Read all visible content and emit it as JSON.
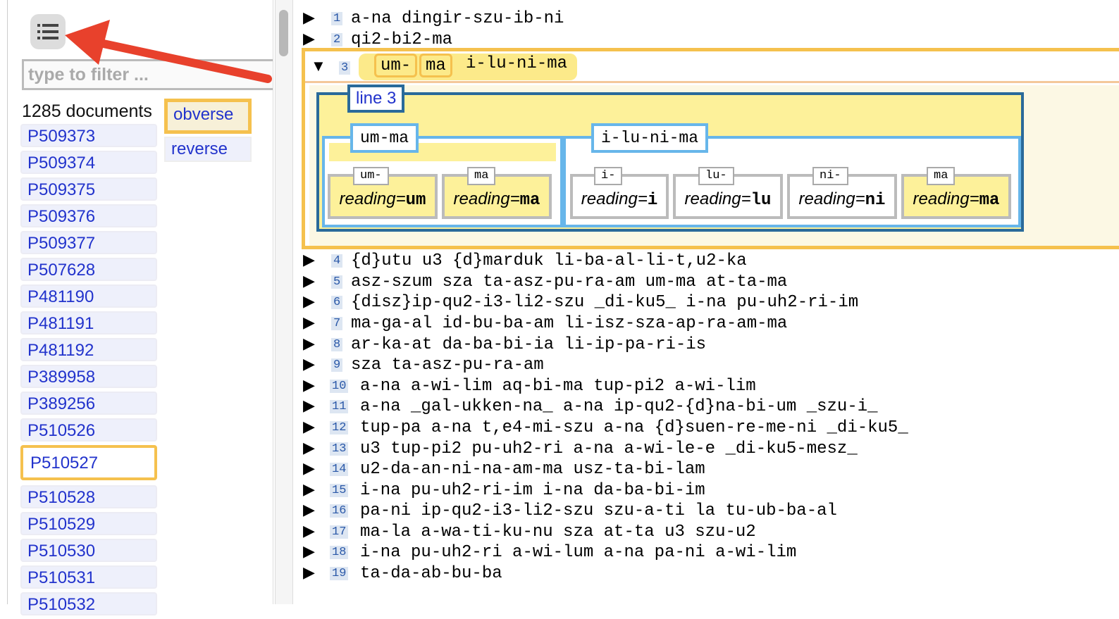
{
  "sidebar": {
    "filter_placeholder": "type to filter ...",
    "doc_count": "1285 documents",
    "docs": [
      "P509373",
      "P509374",
      "P509375",
      "P509376",
      "P509377",
      "P507628",
      "P481190",
      "P481191",
      "P481192",
      "P389958",
      "P389256",
      "P510526",
      "P510527",
      "P510528",
      "P510529",
      "P510530",
      "P510531",
      "P510532"
    ],
    "selected_doc": "P510527",
    "tabs": [
      "obverse",
      "reverse"
    ],
    "selected_tab": "obverse"
  },
  "lines": [
    {
      "n": "1",
      "text": "a-na dingir-szu-ib-ni"
    },
    {
      "n": "2",
      "text": "qi2-bi2-ma"
    },
    {
      "n": "4",
      "text": "{d}utu u3 {d}marduk li-ba-al-li-t,u2-ka"
    },
    {
      "n": "5",
      "text": "asz-szum sza ta-asz-pu-ra-am um-ma at-ta-ma"
    },
    {
      "n": "6",
      "text": "{disz}ip-qu2-i3-li2-szu _di-ku5_ i-na pu-uh2-ri-im"
    },
    {
      "n": "7",
      "text": "ma-ga-al id-bu-ba-am li-isz-sza-ap-ra-am-ma"
    },
    {
      "n": "8",
      "text": "ar-ka-at da-ba-bi-ia li-ip-pa-ri-is"
    },
    {
      "n": "9",
      "text": "sza ta-asz-pu-ra-am"
    },
    {
      "n": "10",
      "text": "a-na a-wi-lim aq-bi-ma tup-pi2 a-wi-lim"
    },
    {
      "n": "11",
      "text": "a-na _gal-ukken-na_ a-na ip-qu2-{d}na-bi-um _szu-i_"
    },
    {
      "n": "12",
      "text": "tup-pa a-na t,e4-mi-szu a-na {d}suen-re-me-ni _di-ku5_"
    },
    {
      "n": "13",
      "text": "u3 tup-pi2 pu-uh2-ri a-na a-wi-le-e _di-ku5-mesz_"
    },
    {
      "n": "14",
      "text": "u2-da-an-ni-na-am-ma usz-ta-bi-lam"
    },
    {
      "n": "15",
      "text": "i-na pu-uh2-ri-im i-na da-ba-bi-im"
    },
    {
      "n": "16",
      "text": "pa-ni ip-qu2-i3-li2-szu szu-a-ti la tu-ub-ba-al"
    },
    {
      "n": "17",
      "text": "ma-la a-wa-ti-ku-nu sza at-ta u3 szu-u2"
    },
    {
      "n": "18",
      "text": "i-na pu-uh2-ri a-wi-lum a-na pa-ni a-wi-lim"
    },
    {
      "n": "19",
      "text": "ta-da-ab-bu-ba"
    }
  ],
  "expanded": {
    "n": "3",
    "chunks": [
      "um-",
      "ma",
      "i-lu-ni-ma"
    ],
    "label": "line 3",
    "words": [
      {
        "label": "um-ma",
        "signs": [
          {
            "tag": "um-",
            "key": "reading=",
            "val": "um"
          },
          {
            "tag": "ma",
            "key": "reading=",
            "val": "ma"
          }
        ]
      },
      {
        "label": "i-lu-ni-ma",
        "signs": [
          {
            "tag": "i-",
            "key": "reading=",
            "val": "i"
          },
          {
            "tag": "lu-",
            "key": "reading=",
            "val": "lu"
          },
          {
            "tag": "ni-",
            "key": "reading=",
            "val": "ni"
          },
          {
            "tag": "ma",
            "key": "reading=",
            "val": "ma"
          }
        ]
      }
    ]
  },
  "icons": {
    "collapsed": "triangle-right",
    "expanded": "triangle-down",
    "menu": "list-icon"
  },
  "colors": {
    "highlight": "#f5c14e",
    "link": "#2233cc",
    "annotation_arrow": "#e8412c",
    "line_box": "#2a6a9a",
    "word_box": "#67b6ea"
  }
}
